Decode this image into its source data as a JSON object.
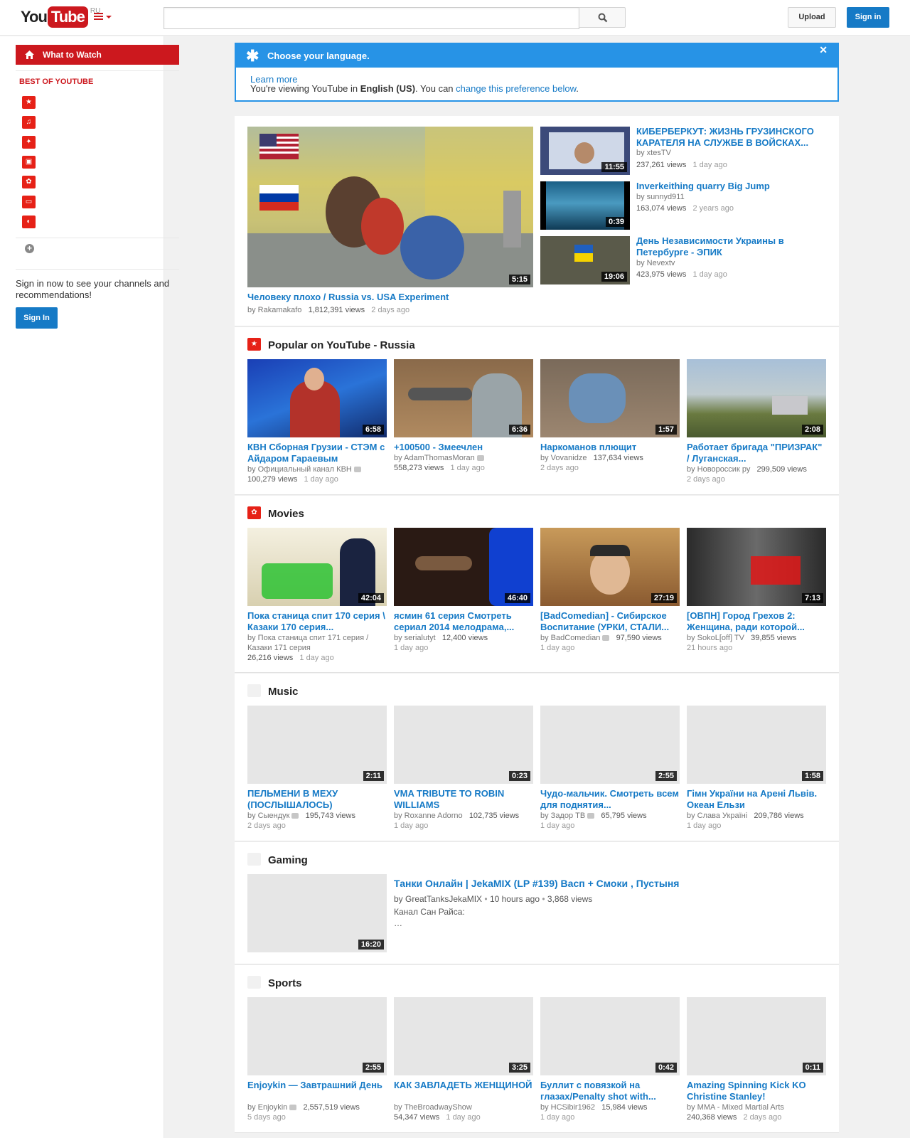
{
  "masthead": {
    "logo_you": "You",
    "logo_tube": "Tube",
    "region": "RU",
    "search_placeholder": "",
    "upload_label": "Upload",
    "signin_label": "Sign in"
  },
  "guide": {
    "what_to_watch": "What to Watch",
    "best_title": "BEST OF YOUTUBE",
    "signin_promo": "Sign in now to see your channels and recommendations!",
    "signin_button": "Sign In"
  },
  "alert": {
    "title": "Choose your language.",
    "learn_more": "Learn more",
    "text_pre": "You're viewing YouTube in ",
    "language": "English (US)",
    "text_mid": ". You can ",
    "change_link": "change this preference below",
    "text_end": "."
  },
  "featured": {
    "main": {
      "title": "Человеку плохо / Russia vs. USA Experiment",
      "by": "by Rakamakafo",
      "views": "1,812,391 views",
      "age": "2 days ago",
      "time": "5:15"
    },
    "side": [
      {
        "title": "КИБЕРБЕРКУТ: ЖИЗНЬ ГРУЗИНСКОГО КАРАТЕЛЯ НА СЛУЖБЕ В ВОЙСКАХ...",
        "by": "by xtesTV",
        "views": "237,261 views",
        "age": "1 day ago",
        "time": "11:55"
      },
      {
        "title": "Inverkeithing quarry Big Jump",
        "by": "by sunnyd911",
        "views": "163,074 views",
        "age": "2 years ago",
        "time": "0:39"
      },
      {
        "title": "День Независимости Украины в Петербурге - ЭПИК",
        "by": "by Nevextv",
        "views": "423,975 views",
        "age": "1 day ago",
        "time": "19:06"
      }
    ]
  },
  "popular": {
    "title": "Popular on YouTube - Russia",
    "videos": [
      {
        "title": "КВН Сборная Грузии - СТЭМ с Айдаром Гараевым",
        "by": "by Официальный канал КВН",
        "views": "100,279 views",
        "age": "1 day ago",
        "time": "6:58"
      },
      {
        "title": "+100500 - Змеечлен",
        "by": "by AdamThomasMoran",
        "views": "558,273 views",
        "age": "1 day ago",
        "time": "6:36"
      },
      {
        "title": "Наркоманов плющит",
        "by": "by Vovanidze",
        "views": "137,634 views",
        "age": "2 days ago",
        "time": "1:57"
      },
      {
        "title": "Работает бригада \"ПРИЗРАК\" / Луганская...",
        "by": "by Новороссик ру",
        "views": "299,509 views",
        "age": "2 days ago",
        "time": "2:08"
      }
    ]
  },
  "movies": {
    "title": "Movies",
    "videos": [
      {
        "title": "Пока станица спит 170 серия \\ Казаки 170 серия...",
        "by": "by Пока станица спит 171 серия / Казаки 171 серия",
        "views": "26,216 views",
        "age": "1 day ago",
        "time": "42:04"
      },
      {
        "title": "ясмин 61 серия Смотреть сериал 2014 мелодрама,...",
        "by": "by serialutyt",
        "views": "12,400 views",
        "age": "1 day ago",
        "time": "46:40"
      },
      {
        "title": "[BadComedian] - Сибирское Воспитание (УРКИ, СТАЛИ...",
        "by": "by BadComedian",
        "views": "97,590 views",
        "age": "1 day ago",
        "time": "27:19"
      },
      {
        "title": "[ОВПН] Город Грехов 2: Женщина, ради которой...",
        "by": "by SokoL[off] TV",
        "views": "39,855 views",
        "age": "21 hours ago",
        "time": "7:13"
      }
    ]
  },
  "music": {
    "title": "Music",
    "videos": [
      {
        "title": "ПЕЛЬМЕНИ В МЕХУ (ПОСЛЫШАЛОСЬ)",
        "by": "by Сыендук",
        "views": "195,743 views",
        "age": "2 days ago",
        "time": "2:11"
      },
      {
        "title": "VMA TRIBUTE TO ROBIN WILLIAMS",
        "by": "by Roxanne Adorno",
        "views": "102,735 views",
        "age": "1 day ago",
        "time": "0:23"
      },
      {
        "title": "Чудо-мальчик. Смотреть всем для поднятия...",
        "by": "by Задор ТВ",
        "views": "65,795 views",
        "age": "1 day ago",
        "time": "2:55"
      },
      {
        "title": "Гімн України на Арені Львів. Океан Ельзи",
        "by": "by Слава Україні",
        "views": "209,786 views",
        "age": "1 day ago",
        "time": "1:58"
      }
    ]
  },
  "gaming": {
    "title": "Gaming",
    "video": {
      "title": "Танки Онлайн | JekaMIX (LP #139) Васп + Смоки , Пустыня",
      "by": "by GreatTanksJekaMIX",
      "age": "10 hours ago",
      "views": "3,868 views",
      "desc": "Канал Сан Райса:",
      "ellipsis": "…",
      "time": "16:20"
    }
  },
  "sports": {
    "title": "Sports",
    "videos": [
      {
        "title": "Enjoykin — Завтрашний День",
        "by": "by Enjoykin",
        "views": "2,557,519 views",
        "age": "5 days ago",
        "time": "2:55"
      },
      {
        "title": "КАК ЗАВЛАДЕТЬ ЖЕНЩИНОЙ",
        "by": "by TheBroadwayShow",
        "views": "54,347 views",
        "age": "1 day ago",
        "time": "3:25"
      },
      {
        "title": "Буллит с повязкой на глазах/Penalty shot with...",
        "by": "by HCSibir1962",
        "views": "15,984 views",
        "age": "1 day ago",
        "time": "0:42"
      },
      {
        "title": "Amazing Spinning Kick KO Christine Stanley!",
        "by": "by MMA - Mixed Martial Arts",
        "views": "240,368 views",
        "age": "2 days ago",
        "time": "0:11"
      }
    ]
  },
  "colors": {
    "brand_red": "#cc181e",
    "link_blue": "#167ac6",
    "alert_blue": "#2793e6"
  }
}
